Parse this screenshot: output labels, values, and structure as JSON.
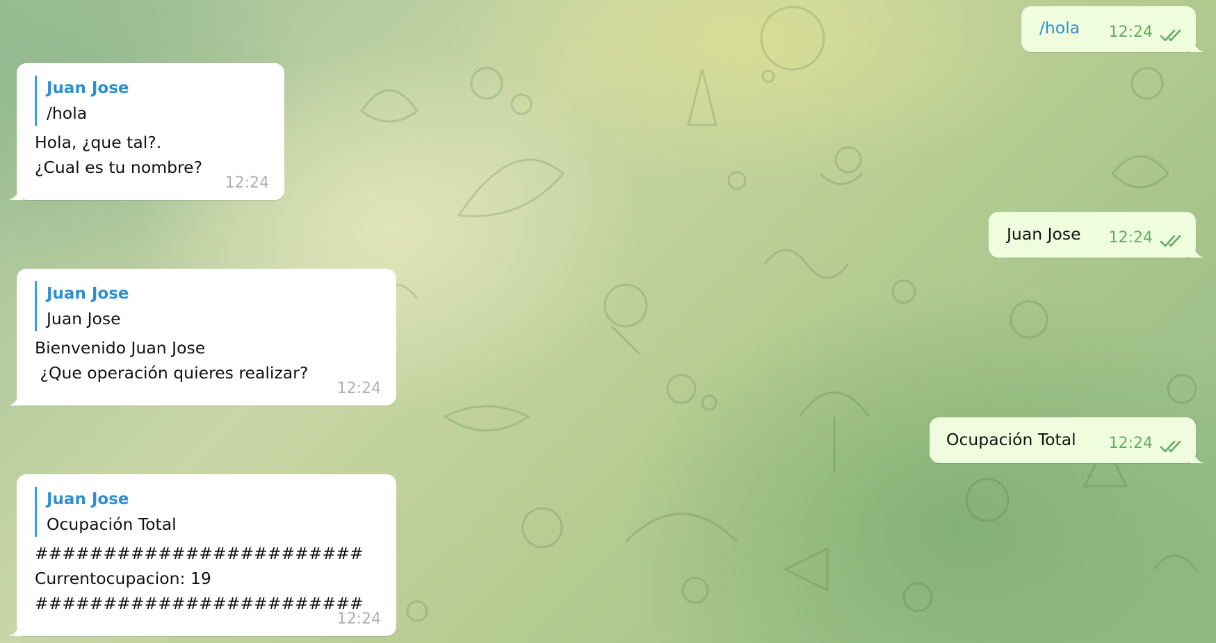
{
  "incoming": [
    {
      "reply_name": "Juan Jose",
      "reply_text": "/hola",
      "body": "Hola, ¿que tal?.\n¿Cual es tu nombre?",
      "time": "12:24"
    },
    {
      "reply_name": "Juan Jose",
      "reply_text": "Juan Jose",
      "body": "Bienvenido Juan Jose\n ¿Que operación quieres realizar?",
      "time": "12:24"
    },
    {
      "reply_name": "Juan Jose",
      "reply_text": "Ocupación Total",
      "body": "########################\nCurrentocupacion: 19\n########################",
      "time": "12:24"
    }
  ],
  "outgoing": [
    {
      "text": "/hola",
      "time": "12:24",
      "status": "read"
    },
    {
      "text": "Juan Jose",
      "time": "12:24",
      "status": "read"
    },
    {
      "text": "Ocupación Total",
      "time": "12:24",
      "status": "read"
    }
  ],
  "colors": {
    "incoming_bg": "#ffffff",
    "outgoing_bg": "#effdde",
    "reply_accent": "#3a9fdd",
    "tick": "#62ab5f"
  }
}
